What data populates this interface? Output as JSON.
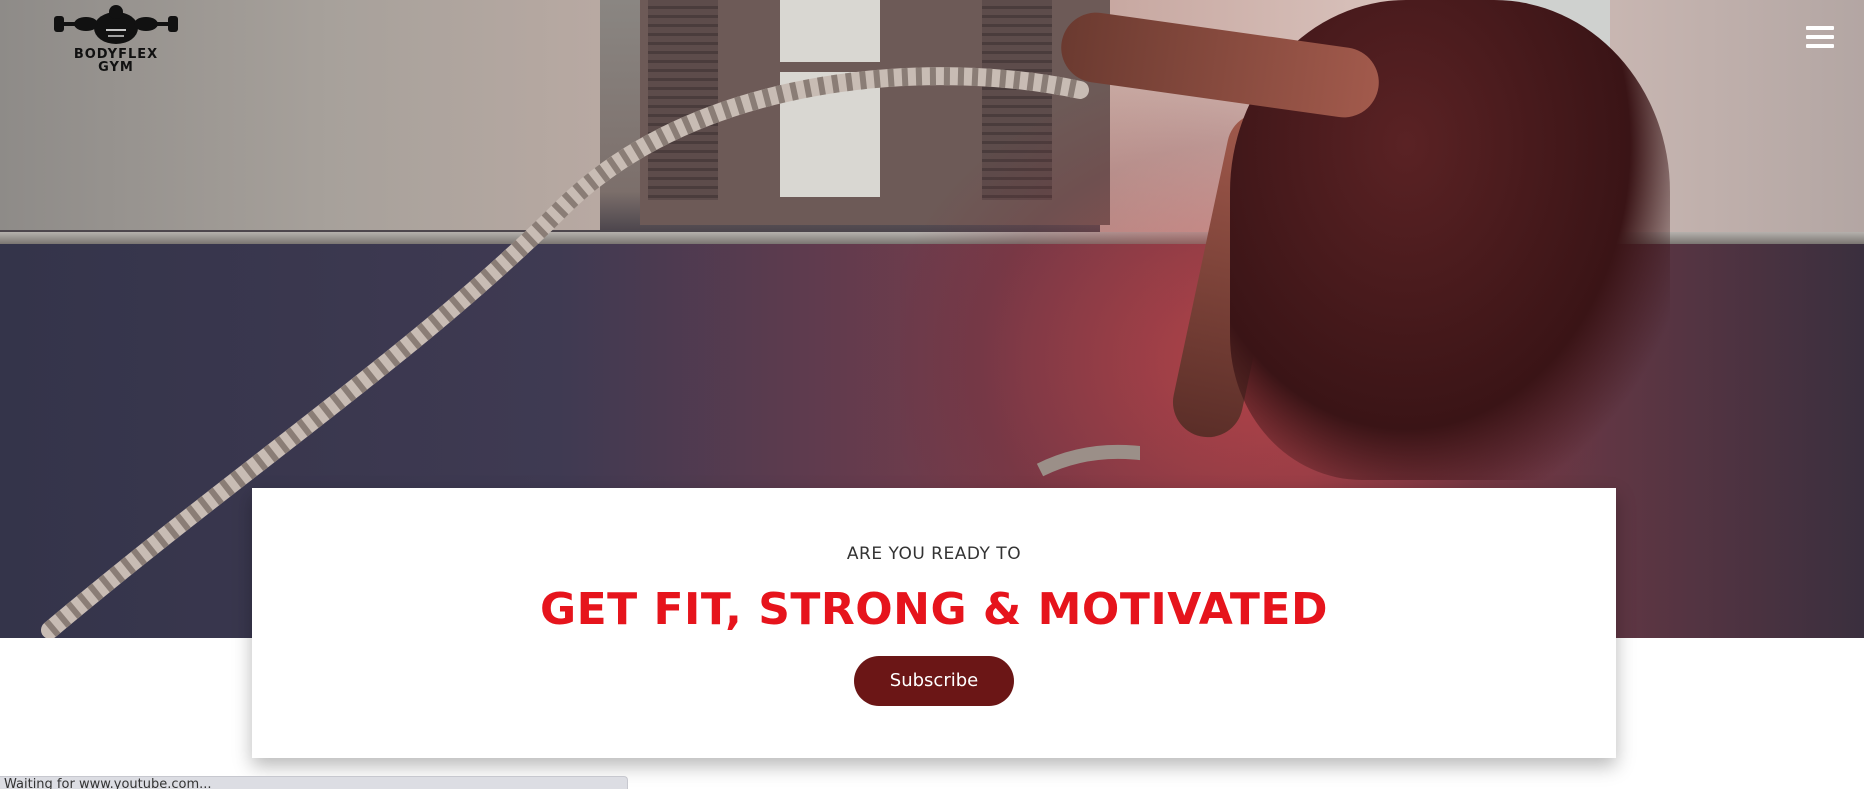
{
  "brand": {
    "name_line1": "BODYFLEX",
    "name_line2": "GYM"
  },
  "hero": {
    "image": "gym-athlete-battle-ropes"
  },
  "header": {
    "menu_icon": "hamburger-icon"
  },
  "card": {
    "kicker": "ARE YOU READY TO",
    "headline": "GET FIT, STRONG & MOTIVATED",
    "button_label": "Subscribe"
  },
  "colors": {
    "headline": "#e6141c",
    "button_bg": "#6b1616",
    "button_text": "#ffffff"
  },
  "status_bar": {
    "text": "Waiting for www.youtube.com..."
  }
}
